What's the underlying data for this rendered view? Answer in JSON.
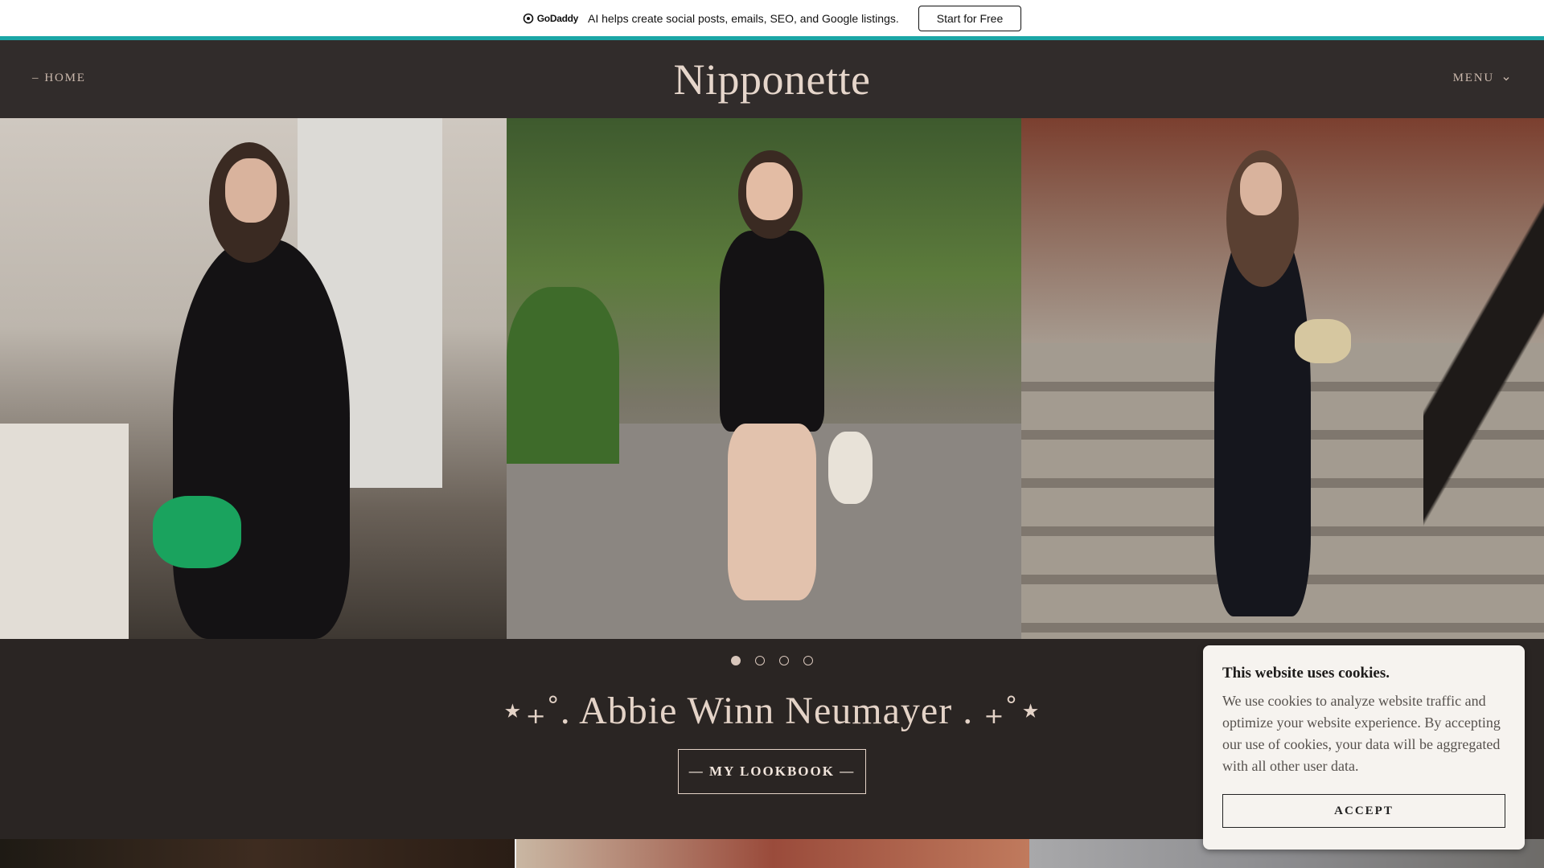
{
  "promo": {
    "brand": "GoDaddy",
    "message": "AI helps create social posts, emails, SEO, and Google listings.",
    "button_label": "Start for Free"
  },
  "header": {
    "home_label": "HOME",
    "brand": "Nipponette",
    "menu_label": "MENU"
  },
  "hero": {
    "slides": 4,
    "active_slide": 1
  },
  "main": {
    "title": "⋆₊˚. Abbie Winn Neumayer . ₊˚⋆",
    "cta_label": "— MY LOOKBOOK —"
  },
  "cookie": {
    "title": "This website uses cookies.",
    "body": "We use cookies to analyze website traffic and optimize your website experience. By accepting our use of cookies, your data will be aggregated with all other user data.",
    "accept_label": "ACCEPT"
  },
  "colors": {
    "teal_accent": "#1ba6a6",
    "header_bg": "#312c2b",
    "page_bg": "#2a2523",
    "text_accent": "#d8c6bb"
  }
}
